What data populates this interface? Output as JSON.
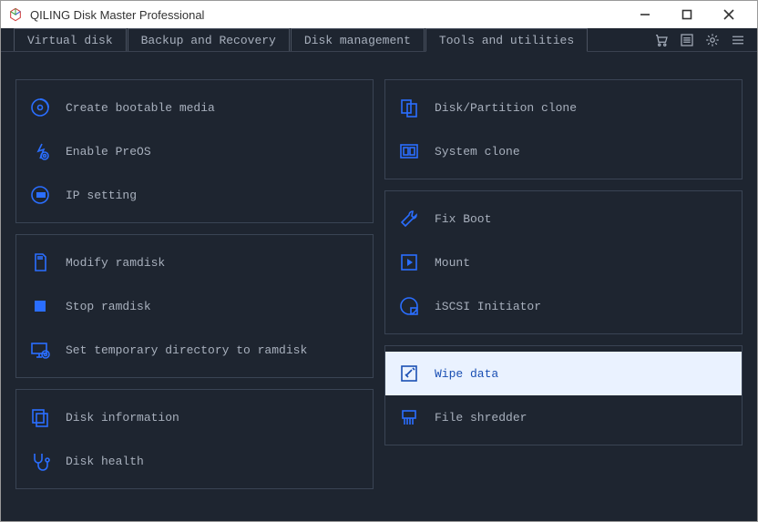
{
  "window": {
    "title": "QILING Disk Master Professional"
  },
  "tabs": [
    {
      "label": "Virtual disk"
    },
    {
      "label": "Backup and Recovery"
    },
    {
      "label": "Disk management"
    },
    {
      "label": "Tools and utilities"
    }
  ],
  "left_groups": [
    {
      "items": [
        {
          "icon": "disc-icon",
          "label": "Create bootable media"
        },
        {
          "icon": "preos-icon",
          "label": "Enable PreOS"
        },
        {
          "icon": "ip-icon",
          "label": "IP setting"
        }
      ]
    },
    {
      "items": [
        {
          "icon": "sd-icon",
          "label": "Modify ramdisk"
        },
        {
          "icon": "stop-icon",
          "label": "Stop ramdisk"
        },
        {
          "icon": "monitor-icon",
          "label": "Set temporary directory to ramdisk"
        }
      ]
    },
    {
      "items": [
        {
          "icon": "diskinfo-icon",
          "label": "Disk information"
        },
        {
          "icon": "stethoscope-icon",
          "label": "Disk health"
        }
      ]
    }
  ],
  "right_groups": [
    {
      "items": [
        {
          "icon": "clone-icon",
          "label": "Disk/Partition clone"
        },
        {
          "icon": "sysclone-icon",
          "label": "System clone"
        }
      ]
    },
    {
      "items": [
        {
          "icon": "wrench-icon",
          "label": "Fix Boot"
        },
        {
          "icon": "play-icon",
          "label": "Mount"
        },
        {
          "icon": "iscsi-icon",
          "label": "iSCSI Initiator"
        }
      ]
    },
    {
      "items": [
        {
          "icon": "wipe-icon",
          "label": "Wipe data",
          "selected": true
        },
        {
          "icon": "shredder-icon",
          "label": "File shredder"
        }
      ]
    }
  ]
}
